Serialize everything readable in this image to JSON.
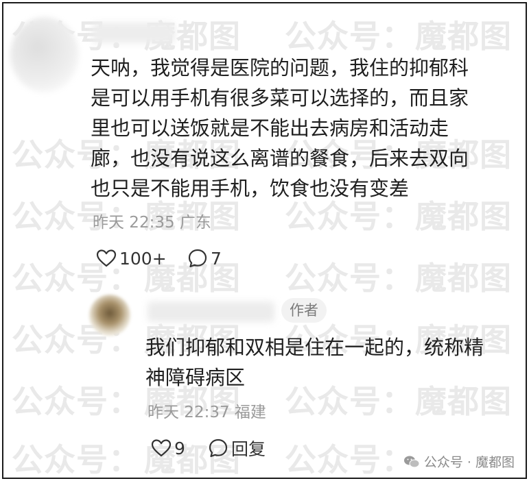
{
  "watermark": {
    "left_text": "公众号：",
    "right_text": "魔都图"
  },
  "comment": {
    "text": "天呐，我觉得是医院的问题，我住的抑郁科\n是可以用手机有很多菜可以选择的，而且家\n里也可以送饭就是不能出去病房和活动走\n廊，也没有说这么离谱的餐食，后来去双向\n也只是不能用手机，饮食也没有变差",
    "time": "昨天 22:35",
    "location": "广东",
    "likes": "100+",
    "comments": "7"
  },
  "reply": {
    "badge": "作者",
    "text": "我们抑郁和双相是住在一起的，统称精\n神障碍病区",
    "time": "昨天 22:37",
    "location": "福建",
    "likes": "9",
    "reply_label": "回复"
  },
  "corner_watermark": {
    "text": "公众号 · 魔都图"
  }
}
